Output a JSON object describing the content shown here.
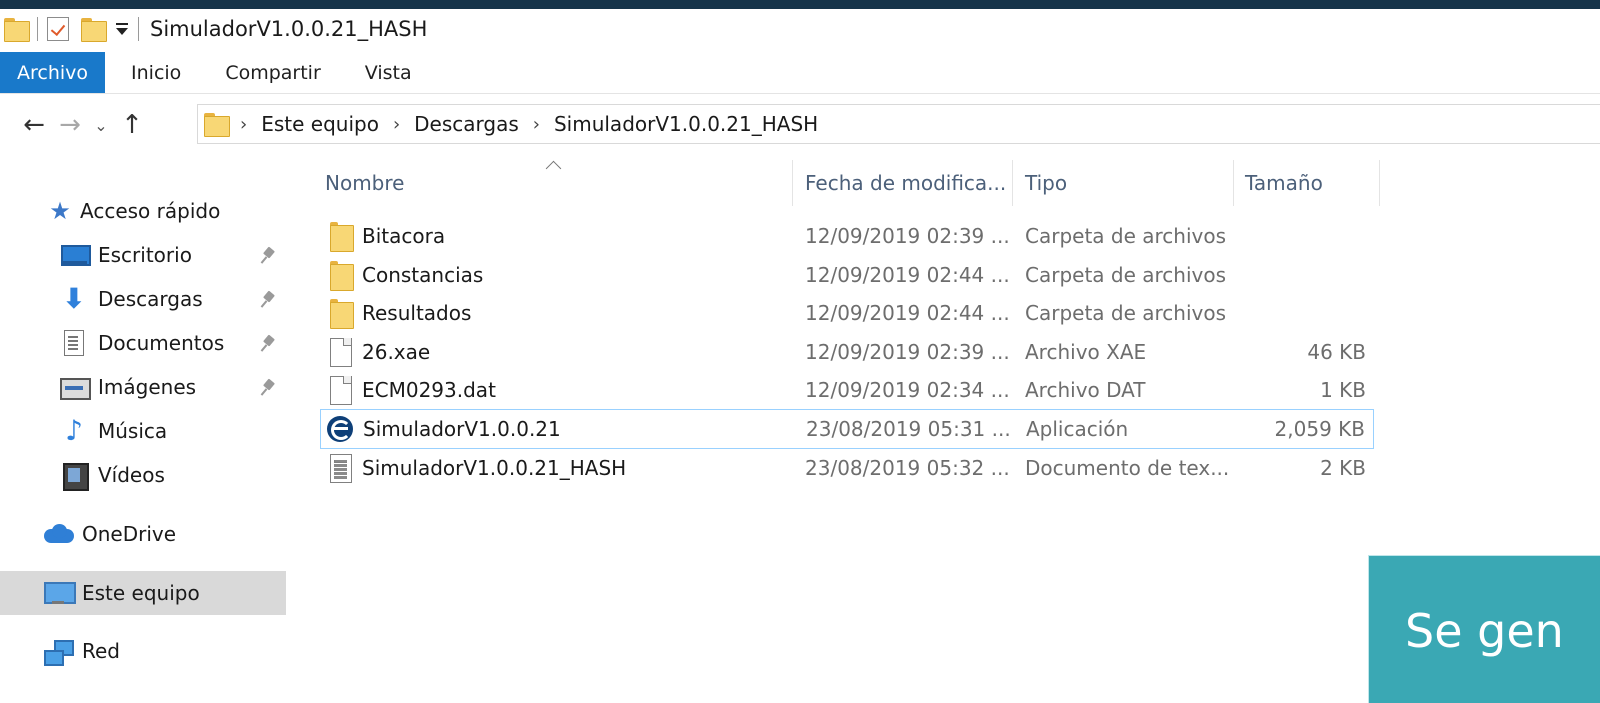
{
  "window": {
    "title": "SimuladorV1.0.0.21_HASH"
  },
  "ribbon": {
    "tabs": [
      "Archivo",
      "Inicio",
      "Compartir",
      "Vista"
    ]
  },
  "address": {
    "crumbs": [
      "Este equipo",
      "Descargas",
      "SimuladorV1.0.0.21_HASH"
    ]
  },
  "sidebar": {
    "quick_access": "Acceso rápido",
    "items": [
      "Escritorio",
      "Descargas",
      "Documentos",
      "Imágenes",
      "Música",
      "Vídeos"
    ],
    "onedrive": "OneDrive",
    "this_pc": "Este equipo",
    "network": "Red"
  },
  "columns": {
    "name": "Nombre",
    "date": "Fecha de modifica...",
    "type": "Tipo",
    "size": "Tamaño"
  },
  "files": [
    {
      "name": "Bitacora",
      "date": "12/09/2019 02:39 ...",
      "type": "Carpeta de archivos",
      "size": "",
      "icon": "folder-icon"
    },
    {
      "name": "Constancias",
      "date": "12/09/2019 02:44 ...",
      "type": "Carpeta de archivos",
      "size": "",
      "icon": "folder-icon"
    },
    {
      "name": "Resultados",
      "date": "12/09/2019 02:44 ...",
      "type": "Carpeta de archivos",
      "size": "",
      "icon": "folder-icon"
    },
    {
      "name": "26.xae",
      "date": "12/09/2019 02:39 ...",
      "type": "Archivo XAE",
      "size": "46 KB",
      "icon": "file-icon"
    },
    {
      "name": "ECM0293.dat",
      "date": "12/09/2019 02:34 ...",
      "type": "Archivo DAT",
      "size": "1 KB",
      "icon": "file-icon"
    },
    {
      "name": "SimuladorV1.0.0.21",
      "date": "23/08/2019 05:31 ...",
      "type": "Aplicación",
      "size": "2,059 KB",
      "icon": "app-icon"
    },
    {
      "name": "SimuladorV1.0.0.21_HASH",
      "date": "23/08/2019 05:32 ...",
      "type": "Documento de tex...",
      "size": "2 KB",
      "icon": "text-file-icon"
    }
  ],
  "overlay": {
    "text": "Se gen"
  },
  "colors": {
    "accent": "#1979ca",
    "overlay": "#3aa8b4",
    "top_strip": "#16344a"
  }
}
